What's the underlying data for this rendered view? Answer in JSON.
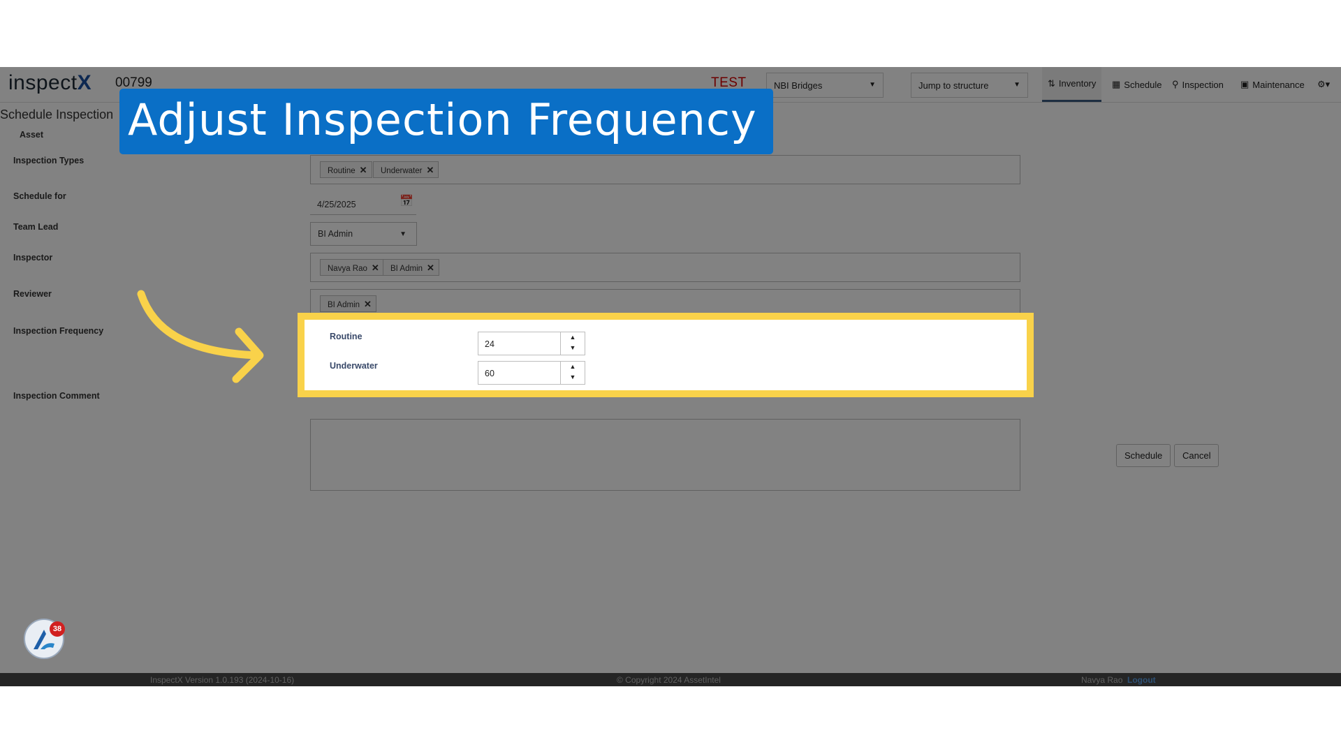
{
  "header": {
    "logo_main": "inspect",
    "logo_x": "X",
    "structure_id": "00799",
    "environment": "TEST",
    "network_select": "NBI Bridges",
    "jump_select": "Jump to structure",
    "nav": [
      {
        "label": "Inventory",
        "icon": "sort-icon"
      },
      {
        "label": "Schedule",
        "icon": "calendar-icon"
      },
      {
        "label": "Inspection",
        "icon": "search-icon"
      },
      {
        "label": "Maintenance",
        "icon": "toolbox-icon"
      }
    ]
  },
  "page": {
    "title": "Schedule Inspection",
    "labels": {
      "asset": "Asset",
      "inspection_types": "Inspection Types",
      "schedule_for": "Schedule for",
      "team_lead": "Team Lead",
      "inspector": "Inspector",
      "reviewer": "Reviewer",
      "inspection_frequency": "Inspection Frequency",
      "inspection_comment": "Inspection Comment"
    },
    "inspection_types": [
      "Routine",
      "Underwater"
    ],
    "schedule_for": "4/25/2025",
    "team_lead": "BI Admin",
    "inspectors": [
      "Navya Rao",
      "BI Admin"
    ],
    "reviewers": [
      "BI Admin"
    ],
    "frequency": [
      {
        "label": "Routine",
        "value": "24"
      },
      {
        "label": "Underwater",
        "value": "60"
      }
    ],
    "buttons": {
      "schedule": "Schedule",
      "cancel": "Cancel"
    }
  },
  "footer": {
    "version": "InspectX Version 1.0.193 (2024-10-16)",
    "copyright": "© Copyright 2024 AssetIntel",
    "user": "Navya Rao",
    "logout": "Logout"
  },
  "notifications": {
    "count": "38"
  },
  "tutorial": {
    "banner": "Adjust Inspection Frequency"
  },
  "colors": {
    "banner": "#0a6fc6",
    "highlight": "#f9d24a",
    "env": "#d40000",
    "footer": "#4a4a4a"
  }
}
